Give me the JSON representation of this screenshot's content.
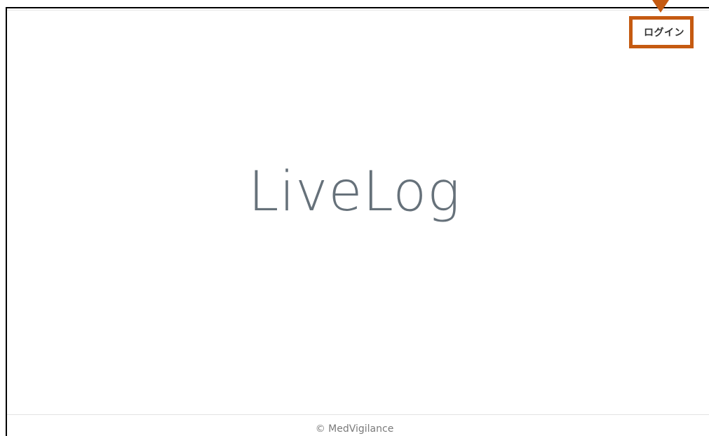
{
  "header": {
    "login_label": "ログイン"
  },
  "hero": {
    "brand_title": "LiveLog"
  },
  "footer": {
    "copyright": "© MedVigilance"
  },
  "annotation": {
    "highlight_color": "#c55a11"
  }
}
